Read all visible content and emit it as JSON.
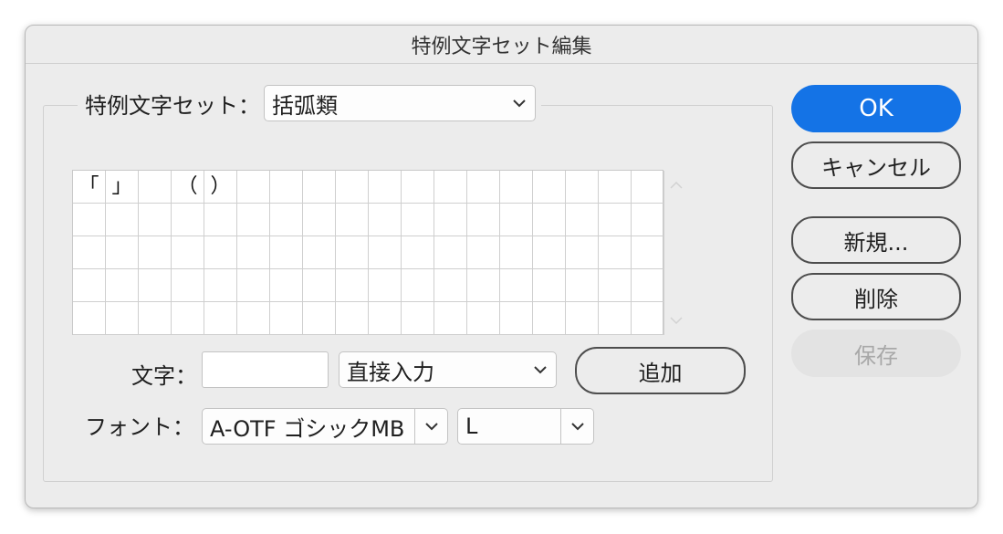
{
  "dialog": {
    "title": "特例文字セット編集"
  },
  "set_selector": {
    "label": "特例文字セット：",
    "value": "括弧類"
  },
  "char_grid": {
    "cells": [
      "「",
      "」",
      "",
      "（",
      "）"
    ]
  },
  "char_input": {
    "label": "文字：",
    "value": "",
    "method_value": "直接入力",
    "add_label": "追加"
  },
  "font": {
    "label": "フォント：",
    "family_value": "A-OTF ゴシックMB",
    "style_value": "L"
  },
  "buttons": {
    "ok": "OK",
    "cancel": "キャンセル",
    "new": "新規...",
    "delete": "削除",
    "save": "保存"
  },
  "colors": {
    "accent": "#1473e6"
  }
}
